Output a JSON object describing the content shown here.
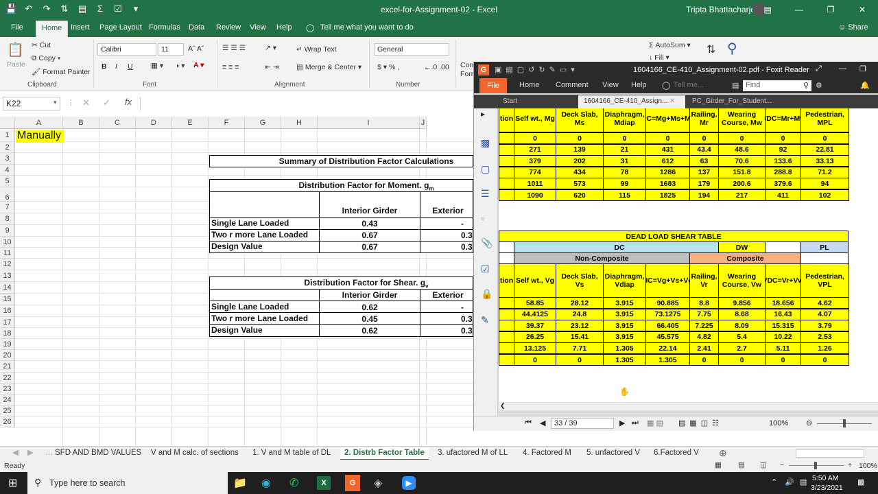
{
  "window": {
    "title": "excel-for-Assignment-02  -  Excel",
    "user": "Tripta Bhattacharjee"
  },
  "ribbon_tabs": [
    "File",
    "Home",
    "Insert",
    "Page Layout",
    "Formulas",
    "Data",
    "Review",
    "View",
    "Help"
  ],
  "tell_me": "Tell me what you want to do",
  "share": "Share",
  "clipboard": {
    "paste": "Paste",
    "cut": "Cut",
    "copy": "Copy",
    "format_painter": "Format Painter",
    "label": "Clipboard"
  },
  "font": {
    "name": "Calibri",
    "size": "11",
    "label": "Font"
  },
  "alignment": {
    "wrap": "Wrap Text",
    "merge": "Merge & Center",
    "label": "Alignment"
  },
  "number": {
    "format": "General",
    "label": "Number"
  },
  "partial": {
    "cond": "Con",
    "form": "Forn"
  },
  "editing": {
    "autosum": "AutoSum",
    "fill": "Fill"
  },
  "name_box": "K22",
  "columns": [
    "A",
    "B",
    "C",
    "D",
    "E",
    "F",
    "G",
    "H",
    "I",
    "J"
  ],
  "rows": [
    "1",
    "2",
    "3",
    "4",
    "5",
    "6",
    "7",
    "8",
    "9",
    "10",
    "11",
    "12",
    "13",
    "14",
    "15",
    "16",
    "17",
    "18",
    "19",
    "20",
    "21",
    "22",
    "23",
    "24",
    "25",
    "26"
  ],
  "cells": {
    "a1": "Manually",
    "summary_title": "Summary of Distribution Factor Calculations",
    "moment_title": "Distribution Factor for Moment. g",
    "moment_sub": "m",
    "shear_title": "Distribution Factor for Shear. g",
    "shear_sub": "v",
    "interior": "Interior Girder",
    "exterior": "Exterior",
    "single": "Single Lane Loaded",
    "two": "Two r more Lane Loaded",
    "design": "Design Value",
    "m_int": [
      "0.43",
      "0.67",
      "0.67"
    ],
    "m_ext": [
      "-",
      "0.3",
      "0.3"
    ],
    "s_int": [
      "0.62",
      "0.45",
      "0.62"
    ],
    "s_ext": [
      "-",
      "0.3",
      "0.3"
    ]
  },
  "sheet_tabs": [
    "SFD AND BMD VALUES",
    "V and M calc. of sections",
    "1. V and M table of DL",
    "2. Distrb Factor Table",
    "3. ufactored M of LL",
    "4.  Factored M",
    "5. unfactored V",
    "6.Factored V"
  ],
  "status": {
    "ready": "Ready",
    "zoom": "100%"
  },
  "taskbar": {
    "search": "Type here to search",
    "time": "5:50 AM",
    "date": "3/23/2021"
  },
  "pdf": {
    "title": "1604166_CE-410_Assignment-02.pdf - Foxit Reader",
    "menu": [
      "File",
      "Home",
      "Comment",
      "View",
      "Help"
    ],
    "tell_me": "Tell me...",
    "find": "Find",
    "tabs": [
      "Start",
      "1604166_CE-410_Assign...",
      "PC_Girder_For_Student..."
    ],
    "page": "33 / 39",
    "zoom": "100%",
    "moment_headers": [
      "tion",
      "Self wt., Mg",
      "Deck Slab, Ms",
      "Diaphragm, Mdiap",
      "MDNC=Mg+Ms+Mdiap",
      "Railing, Mr",
      "Wearing Course, Mw",
      "MDC=Mr+Mw",
      "Pedestrian, MPL"
    ],
    "moment_rows": [
      [
        "0",
        "0",
        "0",
        "0",
        "0",
        "0",
        "0",
        "0"
      ],
      [
        "271",
        "139",
        "21",
        "431",
        "43.4",
        "48.6",
        "92",
        "22.81"
      ],
      [
        "379",
        "202",
        "31",
        "612",
        "63",
        "70.6",
        "133.6",
        "33.13"
      ],
      [
        "774",
        "434",
        "78",
        "1286",
        "137",
        "151.8",
        "288.8",
        "71.2"
      ],
      [
        "1011",
        "573",
        "99",
        "1683",
        "179",
        "200.6",
        "379.6",
        "94"
      ],
      [
        "1090",
        "620",
        "115",
        "1825",
        "194",
        "217",
        "411",
        "102"
      ]
    ],
    "shear_title": "DEAD LOAD SHEAR TABLE",
    "dc": "DC",
    "dw": "DW",
    "pl": "PL",
    "noncomposite": "Non-Composite",
    "composite": "Composite",
    "shear_headers": [
      "tion",
      "Self wt., Vg",
      "Deck Slab, Vs",
      "Diaphragm, Vdiap",
      "VDNC=Vg+Vs+Vdiap",
      "Railing, Vr",
      "Wearing Course, Vw",
      "VDC=Vr+Vw",
      "Pedestrian, VPL"
    ],
    "shear_rows": [
      [
        "58.85",
        "28.12",
        "3.915",
        "90.885",
        "8.8",
        "9.856",
        "18.656",
        "4.62"
      ],
      [
        "44.4125",
        "24.8",
        "3.915",
        "73.1275",
        "7.75",
        "8.68",
        "16.43",
        "4.07"
      ],
      [
        "39.37",
        "23.12",
        "3.915",
        "66.405",
        "7.225",
        "8.09",
        "15.315",
        "3.79"
      ],
      [
        "26.25",
        "15.41",
        "3.915",
        "45.575",
        "4.82",
        "5.4",
        "10.22",
        "2.53"
      ],
      [
        "13.125",
        "7.71",
        "1.305",
        "22.14",
        "2.41",
        "2.7",
        "5.11",
        "1.26"
      ],
      [
        "0",
        "0",
        "1.305",
        "1.305",
        "0",
        "0",
        "0",
        "0"
      ]
    ]
  }
}
